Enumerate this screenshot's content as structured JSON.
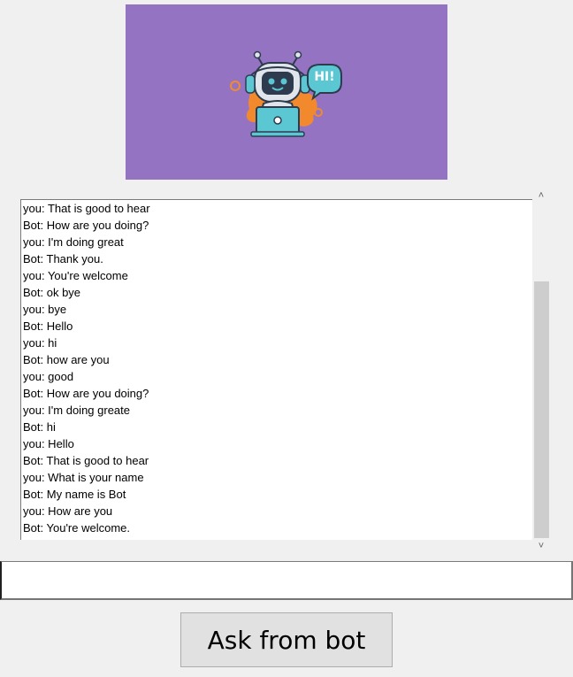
{
  "banner": {
    "bubble_text": "HI!",
    "background_color": "#9474c2"
  },
  "chat": {
    "lines": [
      "you: That is good to hear",
      "Bot: How are you doing?",
      "you: I'm doing great",
      "Bot: Thank you.",
      "you: You're welcome",
      "Bot: ok bye",
      "you: bye",
      "Bot: Hello",
      "you: hi",
      "Bot: how are you",
      "you: good",
      "Bot: How are you doing?",
      "you: I'm doing greate",
      "Bot: hi",
      "you: Hello",
      "Bot: That is good to hear",
      "you: What is your name",
      "Bot: My name is Bot",
      "you: How are you",
      "Bot: You're welcome."
    ],
    "scroll_up_glyph": "˄",
    "scroll_down_glyph": "˅"
  },
  "entry": {
    "value": "",
    "placeholder": ""
  },
  "ask_button": {
    "label": "Ask from bot"
  }
}
